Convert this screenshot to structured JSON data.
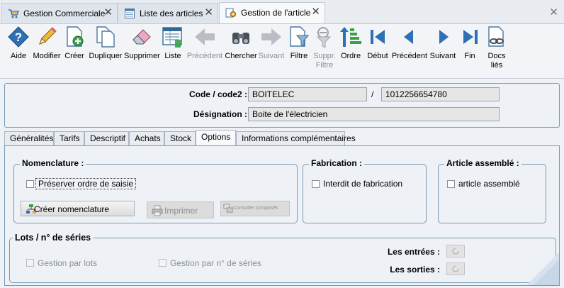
{
  "tabs": [
    {
      "label": "Gestion Commerciale",
      "icon": "cart-icon",
      "active": false
    },
    {
      "label": "Liste des articles",
      "icon": "list-icon",
      "active": false
    },
    {
      "label": "Gestion de l'article",
      "icon": "gear-icon",
      "active": true
    }
  ],
  "toolbar": {
    "aide": "Aide",
    "modifier": "Modifier",
    "creer": "Créer",
    "dupliquer": "Dupliquer",
    "supprimer": "Supprimer",
    "liste": "Liste",
    "precedent": "Précédent",
    "chercher": "Chercher",
    "suivant": "Suivant",
    "filtre": "Filtre",
    "suppr_filtre_1": "Suppr.",
    "suppr_filtre_2": "Filtre",
    "ordre": "Ordre",
    "debut": "Début",
    "precedent2": "Précédent",
    "suivant2": "Suivant",
    "fin": "Fin",
    "docs_1": "Docs",
    "docs_2": "liés"
  },
  "header": {
    "code_label": "Code / code2 :",
    "code_value": "BOITELEC",
    "code_separator": "/",
    "code2_value": "1012256654780",
    "designation_label": "Désignation :",
    "designation_value": "Boite de l'électricien"
  },
  "section_tabs": [
    {
      "label": "Généralités",
      "active": false
    },
    {
      "label": "Tarifs",
      "active": false
    },
    {
      "label": "Descriptif",
      "active": false
    },
    {
      "label": "Achats",
      "active": false
    },
    {
      "label": "Stock",
      "active": false
    },
    {
      "label": "Options",
      "active": true
    },
    {
      "label": "Informations complémentaires",
      "active": false
    }
  ],
  "options": {
    "nomenclature": {
      "title": "Nomenclature :",
      "preserver_label": "Préserver ordre de saisie",
      "creer_button": "Créer nomenclature",
      "imprimer_button": "Imprimer",
      "consulter_button": "Consulter composés"
    },
    "fabrication": {
      "title": "Fabrication :",
      "interdit_label": "Interdit de fabrication"
    },
    "assemble": {
      "title": "Article assemblé :",
      "assemble_label": "article assemblé"
    },
    "lots": {
      "title": "Lots / n° de séries",
      "gestion_lots": "Gestion par lots",
      "gestion_series": "Gestion par n° de séries",
      "entrees_label": "Les entrées :",
      "sorties_label": "Les sorties :"
    }
  }
}
